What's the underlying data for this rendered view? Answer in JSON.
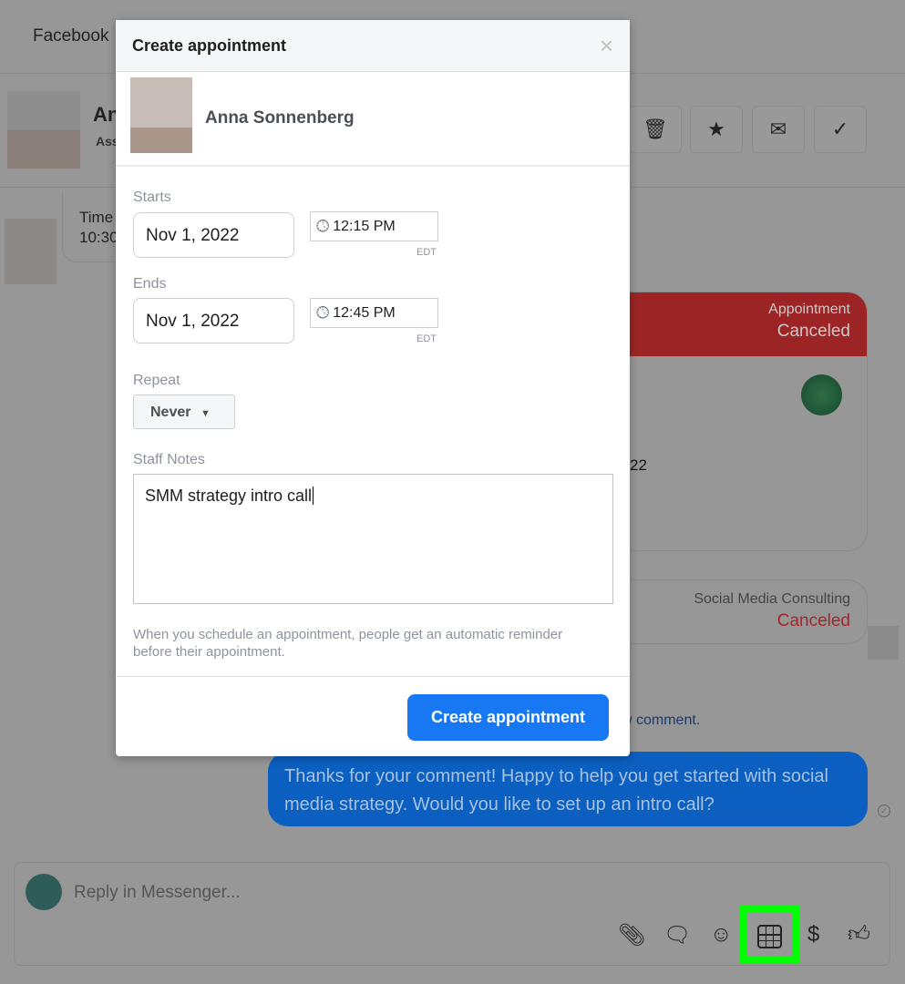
{
  "background": {
    "top_tab": "Facebook",
    "contact_name_partial": "An",
    "contact_sub_partial": "Ass",
    "header_actions": [
      {
        "icon": "trash-icon",
        "glyph": "🗑"
      },
      {
        "icon": "star-icon",
        "glyph": "★"
      },
      {
        "icon": "mail-icon",
        "glyph": "✉"
      },
      {
        "icon": "check-icon",
        "glyph": "✓"
      }
    ],
    "message_partial_line1": "Time",
    "message_partial_line2": "10:30",
    "appointment_card": {
      "label": "Appointment",
      "status": "Canceled",
      "partial_text": "22"
    },
    "service_card": {
      "label": "Social Media Consulting",
      "status": "Canceled"
    },
    "link_partial": "w comment.",
    "sent_message": "Thanks for your comment! Happy to help you get started with social media strategy. Would you like to set up an intro call?",
    "reply_placeholder": "Reply in Messenger...",
    "composer_icons": [
      "paperclip-icon",
      "saved-reply-icon",
      "emoji-icon",
      "calendar-icon",
      "dollar-icon",
      "thumbs-up-icon"
    ],
    "highlight_color": "#00ff00"
  },
  "modal": {
    "title": "Create appointment",
    "close": "×",
    "person_name": "Anna Sonnenberg",
    "starts_label": "Starts",
    "start_date": "Nov 1, 2022",
    "start_time": "12:15 PM",
    "ends_label": "Ends",
    "end_date": "Nov 1, 2022",
    "end_time": "12:45 PM",
    "timezone": "EDT",
    "repeat_label": "Repeat",
    "repeat_value": "Never",
    "notes_label": "Staff Notes",
    "notes_value": "SMM strategy intro call",
    "helper_text": "When you schedule an appointment, people get an automatic reminder before their appointment.",
    "submit_label": "Create appointment",
    "accent": "#1877f2"
  }
}
